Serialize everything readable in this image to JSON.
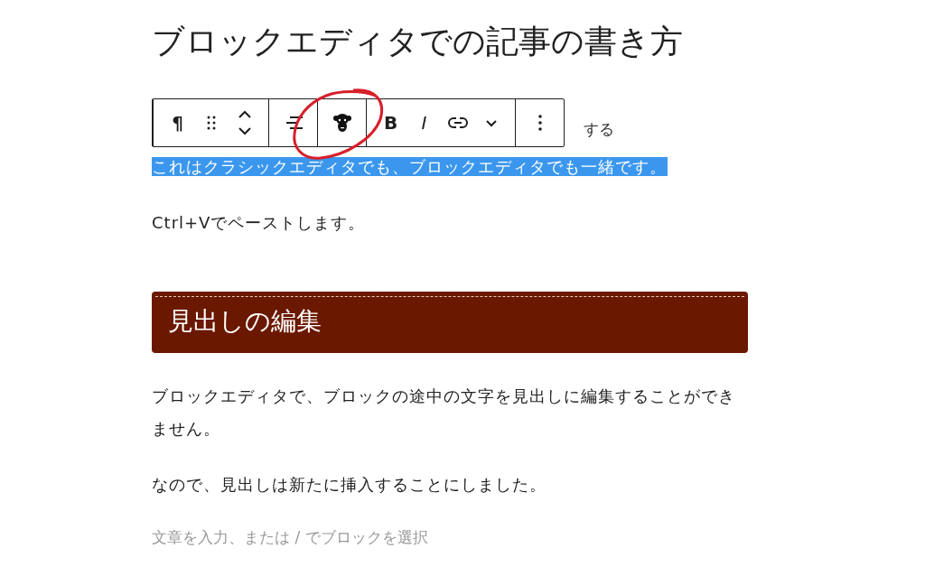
{
  "title": "ブロックエディタでの記事の書き方",
  "toolbar": {
    "groups": [
      {
        "items": [
          {
            "kind": "glyph",
            "label": "¶"
          },
          {
            "kind": "drag"
          },
          {
            "kind": "move"
          }
        ]
      },
      {
        "items": [
          {
            "kind": "align"
          }
        ]
      },
      {
        "items": [
          {
            "kind": "monkey"
          }
        ]
      },
      {
        "items": [
          {
            "kind": "glyph",
            "label": "B"
          },
          {
            "kind": "glyph-italic",
            "label": "I"
          },
          {
            "kind": "link"
          },
          {
            "kind": "caret"
          }
        ]
      },
      {
        "items": [
          {
            "kind": "options"
          }
        ]
      }
    ]
  },
  "annotation": {
    "kind": "circle"
  },
  "blocks": [
    {
      "kind": "partial",
      "text": "する"
    },
    {
      "kind": "paragraph",
      "text": "これはクラシックエディタでも、ブロックエディタでも一緒です。",
      "selected": true
    },
    {
      "kind": "paragraph",
      "text": "Ctrl+Vでペーストします。",
      "selected": false
    },
    {
      "kind": "heading",
      "text": "見出しの編集"
    },
    {
      "kind": "paragraph",
      "text": "ブロックエディタで、ブロックの途中の文字を見出しに編集することができません。",
      "selected": false
    },
    {
      "kind": "paragraph",
      "text": "なので、見出しは新たに挿入することにしました。",
      "selected": false
    },
    {
      "kind": "placeholder",
      "placeholder": "文章を入力、または / でブロックを選択"
    }
  ]
}
